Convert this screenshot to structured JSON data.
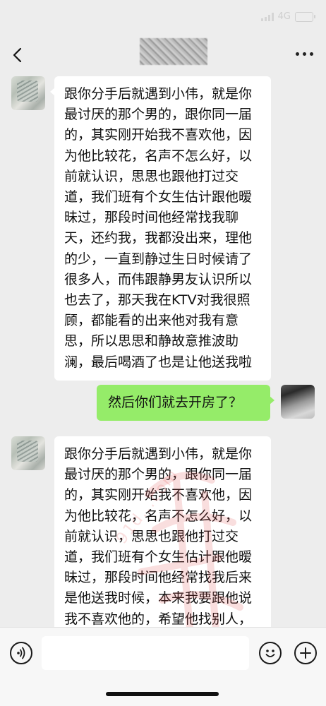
{
  "status_bar": {
    "time": "",
    "network": "4G"
  },
  "header": {
    "contact_name": "",
    "back_icon": "chevron-left-icon",
    "more_icon": "more-dots-icon"
  },
  "messages": [
    {
      "side": "left",
      "text": "跟你分手后就遇到小伟，就是你最讨厌的那个男的，跟你同一届的，其实刚开始我不喜欢他，因为他比较花，名声不怎么好，以前就认识，思思也跟他打过交道，我们班有个女生估计跟他暧昧过，那段时间他经常找我聊天，还约我，我都没出来，理他的少，一直到静过生日时候请了很多人，而伟跟静男友认识所以也去了，那天我在KTV对我很照顾，都能看的出来他对我有意思，所以思思和静故意推波助澜，最后喝酒了也是让他送我啦"
    },
    {
      "side": "right",
      "text": "然后你们就去开房了？"
    },
    {
      "side": "left",
      "text": "跟你分手后就遇到小伟，就是你最讨厌的那个男的，跟你同一届的，其实刚开始我不喜欢他，因为他比较花，名声不怎么好，以前就认识，思思也跟他打过交道，我们班有个女生估计跟他暧昧过，那段时间他经常找我后来是他送我时候，本来我要跟他说我不喜欢他的，希望他找别人，结果就不"
    }
  ],
  "watermark": {
    "text": "91d...com"
  },
  "input_bar": {
    "placeholder": "",
    "voice_icon": "voice-icon",
    "emoji_icon": "emoji-icon",
    "plus_icon": "plus-icon"
  },
  "colors": {
    "background": "#ededed",
    "bubble_left": "#ffffff",
    "bubble_right": "#95ec69",
    "input_bar": "#f7f7f7"
  }
}
